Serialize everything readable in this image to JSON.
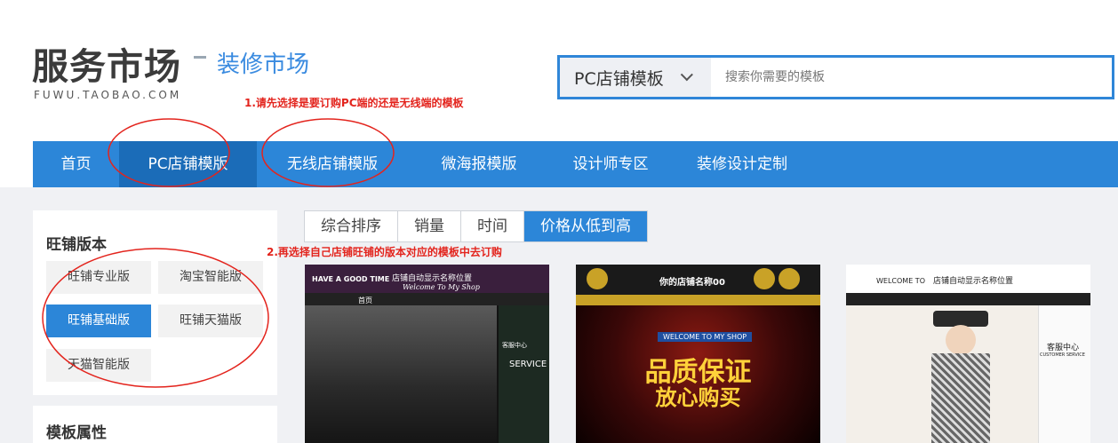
{
  "header": {
    "logo_text": "服务市场",
    "logo_sub": "FUWU.TAOBAO.COM",
    "market_title": "装修市场",
    "search": {
      "category": "PC店铺模板",
      "placeholder": "搜索你需要的模板"
    }
  },
  "annotations": {
    "step1": "1.请先选择是要订购PC端的还是无线端的模板",
    "step2": "2.再选择自己店铺旺铺的版本对应的模板中去订购"
  },
  "nav": {
    "items": [
      {
        "label": "首页"
      },
      {
        "label": "PC店铺模版",
        "active": true
      },
      {
        "label": "无线店铺模版"
      },
      {
        "label": "微海报模版"
      },
      {
        "label": "设计师专区"
      },
      {
        "label": "装修设计定制"
      }
    ]
  },
  "sidebar": {
    "version_title": "旺铺版本",
    "versions": [
      {
        "label": "旺铺专业版"
      },
      {
        "label": "淘宝智能版"
      },
      {
        "label": "旺铺基础版",
        "active": true
      },
      {
        "label": "旺铺天猫版"
      },
      {
        "label": "天猫智能版"
      }
    ],
    "attr_title": "模板属性"
  },
  "sort": {
    "items": [
      {
        "label": "综合排序"
      },
      {
        "label": "销量"
      },
      {
        "label": "时间"
      },
      {
        "label": "价格从低到高",
        "active": true
      }
    ]
  },
  "cards": [
    {
      "top_left": "HAVE A GOOD TIME",
      "shop_name": "店铺自动显示名称位置",
      "tagline": "Welcome To My Shop",
      "nav_label": "首页",
      "side_cs": "客服中心",
      "side_service": "SERVICE"
    },
    {
      "shop_name": "你的店铺名称00",
      "banner": "WELCOME TO MY SHOP",
      "headline1": "品质保证",
      "headline2": "放心购买"
    },
    {
      "top_left": "WELCOME TO",
      "shop_name": "店铺自动显示名称位置",
      "side_cs": "客服中心",
      "side_service": "CUSTOMER SERVICE"
    }
  ],
  "colors": {
    "accent": "#2c86d8",
    "nav_active": "#1b6cb8",
    "annotation": "#e3241d"
  }
}
